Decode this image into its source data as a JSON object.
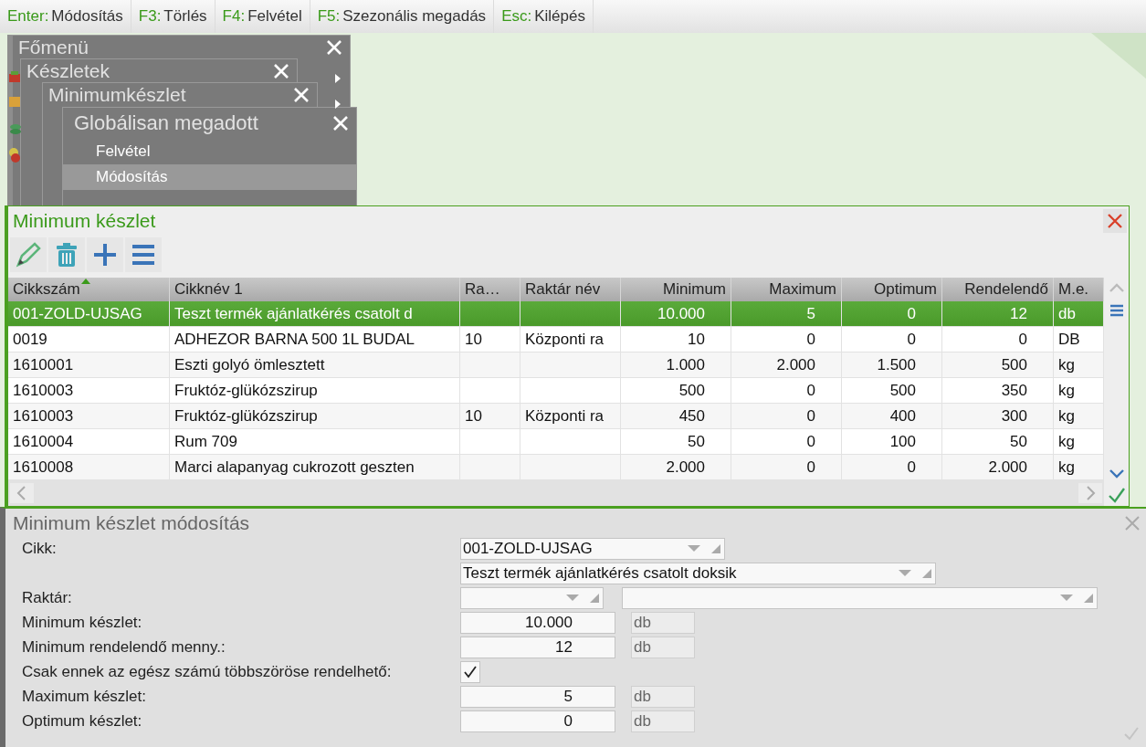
{
  "shortcuts": [
    {
      "key": "Enter:",
      "action": "Módosítás"
    },
    {
      "key": "F3:",
      "action": "Törlés"
    },
    {
      "key": "F4:",
      "action": "Felvétel"
    },
    {
      "key": "F5:",
      "action": "Szezonális megadás"
    },
    {
      "key": "Esc:",
      "action": "Kilépés"
    }
  ],
  "menu_windows": [
    {
      "title": "Főmenü"
    },
    {
      "title": "Készletek"
    },
    {
      "title": "Minimumkészlet"
    },
    {
      "title": "Globálisan megadott",
      "items": [
        {
          "label": "Felvétel",
          "selected": false
        },
        {
          "label": "Módosítás",
          "selected": true
        }
      ]
    }
  ],
  "list_panel": {
    "title": "Minimum készlet",
    "columns": [
      {
        "label": "Cikkszám",
        "kind": "text",
        "sorted": true
      },
      {
        "label": "Cikknév 1",
        "kind": "text",
        "sorted": false
      },
      {
        "label": "Ra…",
        "kind": "text",
        "sorted": false
      },
      {
        "label": "Raktár név",
        "kind": "text",
        "sorted": false
      },
      {
        "label": "Minimum",
        "kind": "number",
        "sorted": false
      },
      {
        "label": "Maximum",
        "kind": "number",
        "sorted": false
      },
      {
        "label": "Optimum",
        "kind": "number",
        "sorted": false
      },
      {
        "label": "Rendelendő",
        "kind": "number",
        "sorted": false
      },
      {
        "label": "M.e.",
        "kind": "text",
        "sorted": false
      }
    ],
    "rows": [
      {
        "selected": true,
        "cells": [
          "001-ZOLD-UJSAG",
          "Teszt termék ajánlatkérés csatolt d",
          "",
          "",
          "10.000",
          "5",
          "0",
          "12",
          "db"
        ]
      },
      {
        "selected": false,
        "cells": [
          "0019",
          "ADHEZOR BARNA 500 1L BUDAL",
          "10",
          "Központi ra",
          "10",
          "0",
          "0",
          "0",
          "DB"
        ]
      },
      {
        "selected": false,
        "cells": [
          "1610001",
          "Eszti golyó ömlesztett",
          "",
          "",
          "1.000",
          "2.000",
          "1.500",
          "500",
          "kg"
        ]
      },
      {
        "selected": false,
        "cells": [
          "1610003",
          "Fruktóz-glükózszirup",
          "",
          "",
          "500",
          "0",
          "500",
          "350",
          "kg"
        ]
      },
      {
        "selected": false,
        "cells": [
          "1610003",
          "Fruktóz-glükózszirup",
          "10",
          "Központi ra",
          "450",
          "0",
          "400",
          "300",
          "kg"
        ]
      },
      {
        "selected": false,
        "cells": [
          "1610004",
          "Rum 709",
          "",
          "",
          "50",
          "0",
          "100",
          "50",
          "kg"
        ]
      },
      {
        "selected": false,
        "cells": [
          "1610008",
          "Marci alapanyag cukrozott geszten",
          "",
          "",
          "2.000",
          "0",
          "0",
          "2.000",
          "kg"
        ]
      }
    ]
  },
  "edit_panel": {
    "title": "Minimum készlet módosítás",
    "fields": [
      {
        "kind": "select",
        "label": "Cikk:",
        "value": "001-ZOLD-UJSAG"
      },
      {
        "kind": "select-wide",
        "value": "Teszt termék ajánlatkérés csatolt doksik"
      },
      {
        "kind": "select-pair",
        "label": "Raktár:"
      },
      {
        "kind": "number",
        "label": "Minimum készlet:",
        "value": "10.000",
        "unit": "db"
      },
      {
        "kind": "number",
        "label": "Minimum rendelendő menny.:",
        "value": "12",
        "unit": "db"
      },
      {
        "kind": "checkbox",
        "label": "Csak ennek az egész számú többszöröse rendelhető:",
        "checked": true
      },
      {
        "kind": "number",
        "label": "Maximum készlet:",
        "value": "5",
        "unit": "db"
      },
      {
        "kind": "number",
        "label": "Optimum készlet:",
        "value": "0",
        "unit": "db"
      }
    ]
  }
}
